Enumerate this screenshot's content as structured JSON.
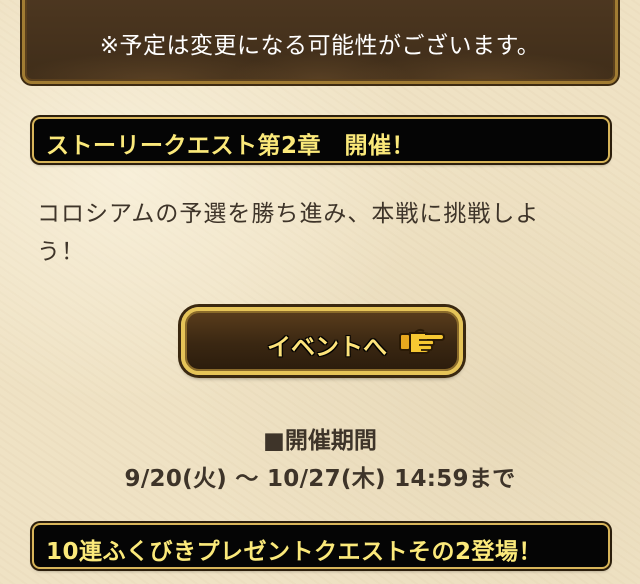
{
  "notice": {
    "text": "※予定は変更になる可能性がございます。"
  },
  "headline_1": {
    "text": "ストーリークエスト第2章　開催！"
  },
  "description": {
    "line_1": "コロシアムの予選を勝ち進み、本戦に挑戦しよ",
    "line_2": "う！"
  },
  "event_button": {
    "label": "イベントへ",
    "icon": "pointing-hand-icon"
  },
  "period": {
    "label": "■開催期間",
    "value": "9/20(火) 〜 10/27(木) 14:59まで"
  },
  "headline_2": {
    "text": "10連ふくびきプレゼントクエストその2登場！"
  },
  "colors": {
    "headline_text": "#fbe97a",
    "headline_bg": "#050505",
    "panel_bg": "#4a3520",
    "gold_border": "#d8b55a",
    "body_text": "#3e3429",
    "page_bg": "#efe2c4"
  }
}
